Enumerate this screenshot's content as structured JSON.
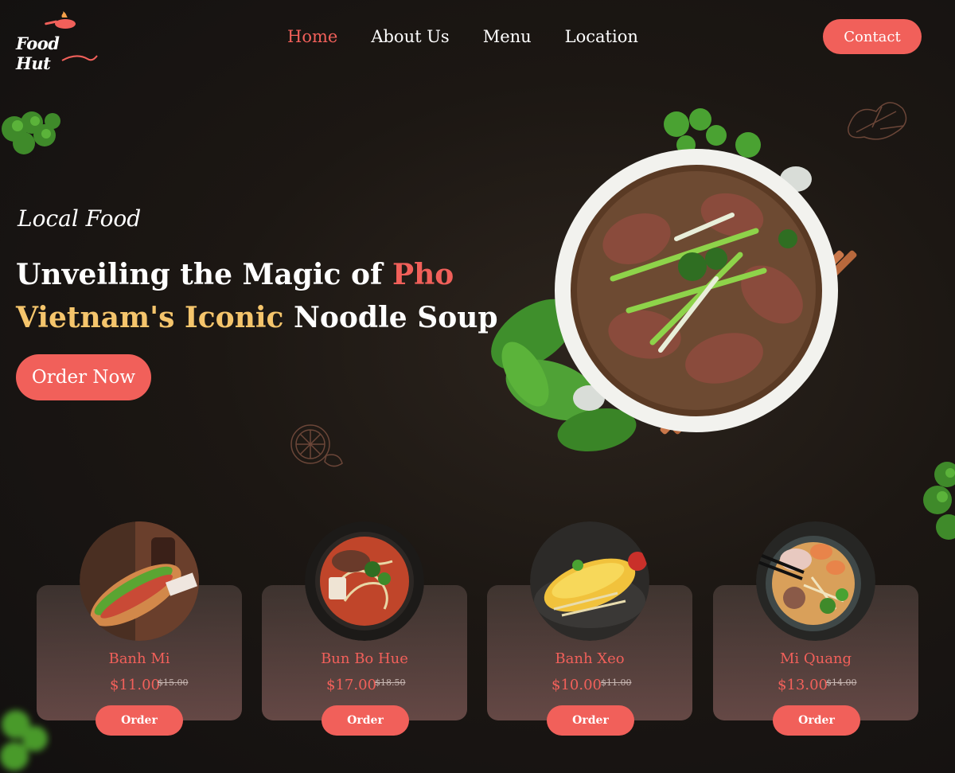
{
  "brand": {
    "logo_text": "Food Hut",
    "accent": "#f1605a",
    "highlight": "#f5c56c"
  },
  "nav": {
    "items": [
      {
        "label": "Home",
        "active": true
      },
      {
        "label": "About Us",
        "active": false
      },
      {
        "label": "Menu",
        "active": false
      },
      {
        "label": "Location",
        "active": false
      }
    ],
    "contact_label": "Contact"
  },
  "hero": {
    "eyebrow": "Local Food",
    "line1_a": "Unveiling the Magic of ",
    "line1_b": "Pho",
    "line2_a": "Vietnam's Iconic",
    "line2_b": " Noodle Soup",
    "cta_label": "Order Now",
    "image": "pho-bowl-with-herbs-and-chopsticks"
  },
  "menu_cards": [
    {
      "name": "Banh Mi",
      "price": "$11.00",
      "old_price": "$15.00",
      "button": "Order",
      "image": "banh-mi-sandwich"
    },
    {
      "name": "Bun Bo Hue",
      "price": "$17.00",
      "old_price": "$18.50",
      "button": "Order",
      "image": "bun-bo-hue-bowl"
    },
    {
      "name": "Banh Xeo",
      "price": "$10.00",
      "old_price": "$11.00",
      "button": "Order",
      "image": "banh-xeo-pancake"
    },
    {
      "name": "Mi Quang",
      "price": "$13.00",
      "old_price": "$14.00",
      "button": "Order",
      "image": "mi-quang-bowl"
    }
  ]
}
